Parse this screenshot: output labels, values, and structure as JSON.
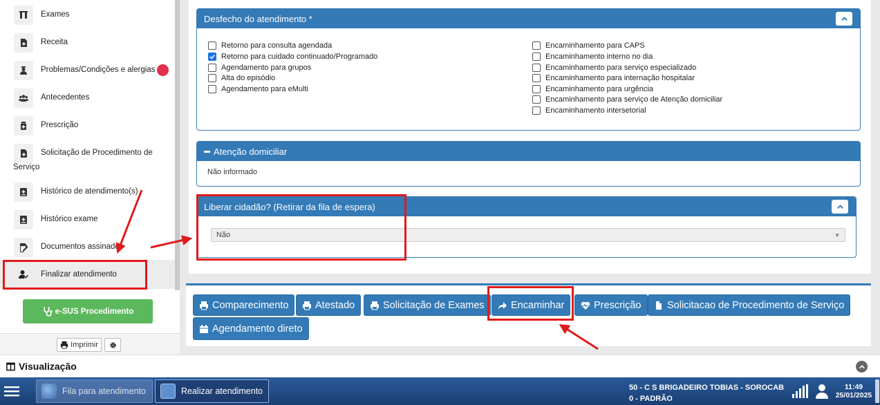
{
  "sidebar": {
    "items": [
      {
        "label": "Exames",
        "icon": "test-tubes-icon"
      },
      {
        "label": "Receita",
        "icon": "file-plus-icon"
      },
      {
        "label": "Problemas/Condições e alergias",
        "icon": "user-nurse-icon"
      },
      {
        "label": "Antecedentes",
        "icon": "users-icon"
      },
      {
        "label": "Prescrição",
        "icon": "medicine-icon"
      },
      {
        "label": "Solicitação de Procedimento de Serviço",
        "label_line1": "Solicitação de Procedimento de",
        "label_line2": "Serviço",
        "icon": "file-plus-icon"
      },
      {
        "label": "Histórico de atendimento(s)",
        "icon": "history-icon"
      },
      {
        "label": "Histórico exame",
        "icon": "history-icon"
      },
      {
        "label": "Documentos assinados",
        "icon": "signature-icon"
      },
      {
        "label": "Finalizar atendimento",
        "icon": "user-check-icon",
        "active": true
      }
    ],
    "esus_button": "e-SUS Procedimento",
    "print_button": "Imprimir"
  },
  "desfecho": {
    "title": "Desfecho do atendimento *",
    "left_options": [
      {
        "label": "Retorno para consulta agendada",
        "checked": false
      },
      {
        "label": "Retorno para cuidado continuado/Programado",
        "checked": true
      },
      {
        "label": "Agendamento para grupos",
        "checked": false
      },
      {
        "label": "Alta do episódio",
        "checked": false
      },
      {
        "label": "Agendamento para eMulti",
        "checked": false
      }
    ],
    "right_options": [
      {
        "label": "Encaminhamento para CAPS",
        "checked": false
      },
      {
        "label": "Encaminhamento interno no dia",
        "checked": false
      },
      {
        "label": "Encaminhamento para serviço especializado",
        "checked": false
      },
      {
        "label": "Encaminhamento para internação hospitalar",
        "checked": false
      },
      {
        "label": "Encaminhamento para urgência",
        "checked": false
      },
      {
        "label": "Encaminhamento para serviço de Atenção domiciliar",
        "checked": false
      },
      {
        "label": "Encaminhamento intersetorial",
        "checked": false
      }
    ]
  },
  "atencao": {
    "title": "Atenção domiciliar",
    "value": "Não informado"
  },
  "liberar": {
    "title": "Liberar cidadão? (Retirar da fila de espera)",
    "selected": "Não"
  },
  "actions": {
    "comparecimento": "Comparecimento",
    "atestado": "Atestado",
    "solicitacao_exames": "Solicitação de Exames",
    "encaminhar": "Encaminhar",
    "prescricao": "Prescrição",
    "solicitacao_procedimento": "Solicitacao de Procedimento de Serviço",
    "agendamento": "Agendamento direto"
  },
  "visualizacao": {
    "title": "Visualização"
  },
  "taskbar": {
    "app1": "Fila para atendimento",
    "app2": "Realizar atendimento",
    "unit_line1": "50 - C S BRIGADEIRO TOBIAS - SOROCAB",
    "unit_line2": "0 - PADRÃO",
    "time": "11:49",
    "date": "25/01/2025"
  },
  "colors": {
    "primary": "#337ab7",
    "success": "#5cb85c",
    "annotation_red": "#e01b1b",
    "alert_dot": "#e0304b"
  }
}
